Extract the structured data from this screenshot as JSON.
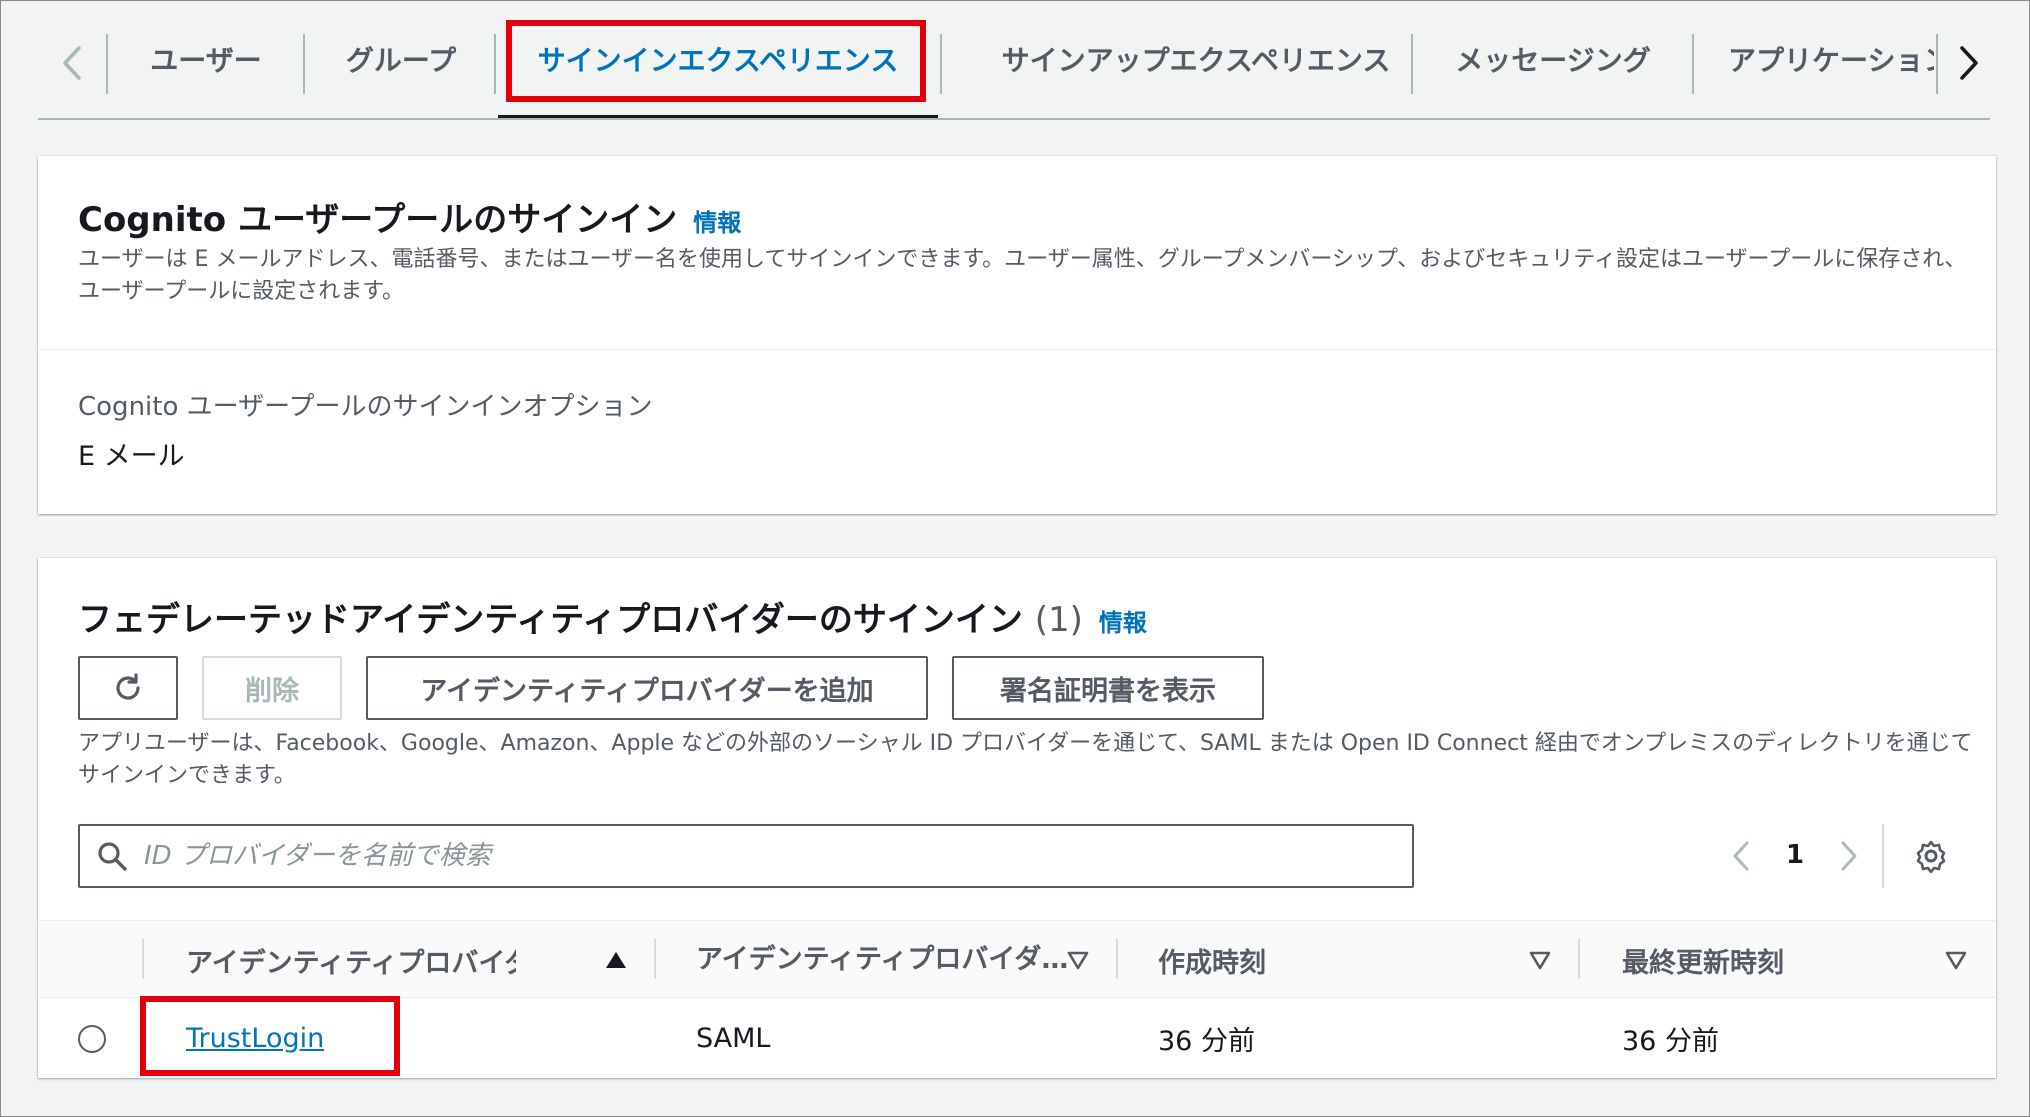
{
  "tabs": {
    "items": [
      {
        "label": "ユーザー"
      },
      {
        "label": "グループ"
      },
      {
        "label": "サインインエクスペリエンス"
      },
      {
        "label": "サインアップエクスペリエンス"
      },
      {
        "label": "メッセージング"
      },
      {
        "label": "アプリケーション統合"
      }
    ],
    "active_index": 2
  },
  "signin_panel": {
    "title": "Cognito ユーザープールのサインイン",
    "info": "情報",
    "description": "ユーザーは E メールアドレス、電話番号、またはユーザー名を使用してサインインできます。ユーザー属性、グループメンバーシップ、およびセキュリティ設定はユーザープールに保存され、ユーザープールに設定されます。",
    "option_label": "Cognito ユーザープールのサインインオプション",
    "option_value": "E メール"
  },
  "federated_panel": {
    "title": "フェデレーテッドアイデンティティプロバイダーのサインイン",
    "count": "(1)",
    "info": "情報",
    "buttons": {
      "delete": "削除",
      "add_provider": "アイデンティティプロバイダーを追加",
      "show_cert": "署名証明書を表示"
    },
    "description": "アプリユーザーは、Facebook、Google、Amazon、Apple などの外部のソーシャル ID プロバイダーを通じて、SAML または Open ID Connect 経由でオンプレミスのディレクトリを通じてサインインできます。",
    "search_placeholder": "ID プロバイダーを名前で検索",
    "pagination": {
      "current_page": "1"
    },
    "table": {
      "columns": [
        "アイデンティティプロバイダー",
        "アイデンティティプロバイダーのタイプ",
        "作成時刻",
        "最終更新時刻"
      ],
      "rows": [
        {
          "name": "TrustLogin",
          "type": "SAML",
          "created": "36 分前",
          "updated": "36 分前"
        }
      ]
    }
  },
  "colors": {
    "accent": "#0073bb",
    "highlight": "#e3000b",
    "text": "#16191f",
    "muted": "#545b64"
  }
}
